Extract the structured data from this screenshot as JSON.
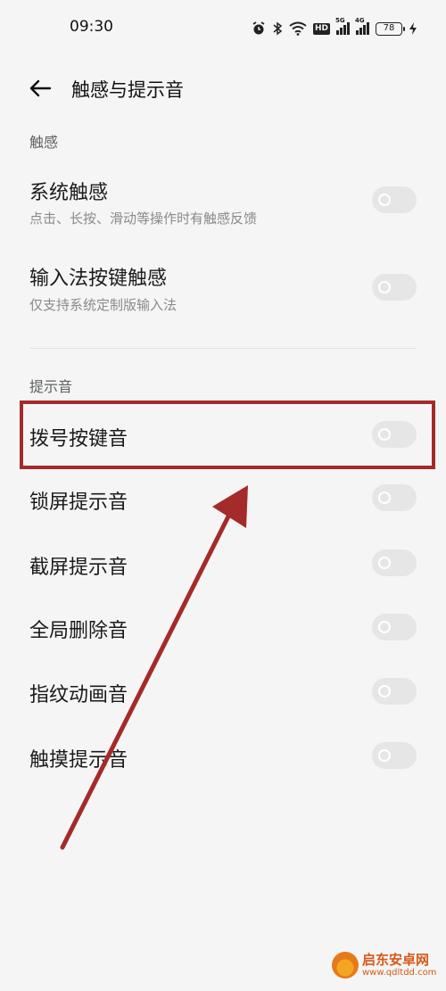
{
  "status_bar": {
    "time": "09:30",
    "battery": "78",
    "hd": "HD",
    "signal1_gen": "5G",
    "signal2_gen": "4G",
    "icons": [
      "alarm-icon",
      "bluetooth-icon",
      "wifi-icon",
      "hd-icon",
      "signal-icon",
      "signal-icon",
      "battery-icon",
      "charging-icon"
    ]
  },
  "header": {
    "title": "触感与提示音",
    "back_icon": "back-arrow-icon"
  },
  "sections": {
    "haptics": {
      "label": "触感",
      "items": [
        {
          "title": "系统触感",
          "subtitle": "点击、长按、滑动等操作时有触感反馈",
          "enabled": false
        },
        {
          "title": "输入法按键触感",
          "subtitle": "仅支持系统定制版输入法",
          "enabled": false
        }
      ]
    },
    "sounds": {
      "label": "提示音",
      "items": [
        {
          "title": "拨号按键音",
          "enabled": false
        },
        {
          "title": "锁屏提示音",
          "enabled": false
        },
        {
          "title": "截屏提示音",
          "enabled": false
        },
        {
          "title": "全局删除音",
          "enabled": false
        },
        {
          "title": "指纹动画音",
          "enabled": false
        },
        {
          "title": "触摸提示音",
          "enabled": false
        }
      ]
    }
  },
  "annotation": {
    "color": "#a52a2a",
    "highlighted_item": "拨号按键音"
  },
  "watermark": {
    "name": "启东安卓网",
    "url": "www.qdltdd.com"
  },
  "colors": {
    "background": "#f5f5f5",
    "toggle_off": "#e6e6e6"
  }
}
